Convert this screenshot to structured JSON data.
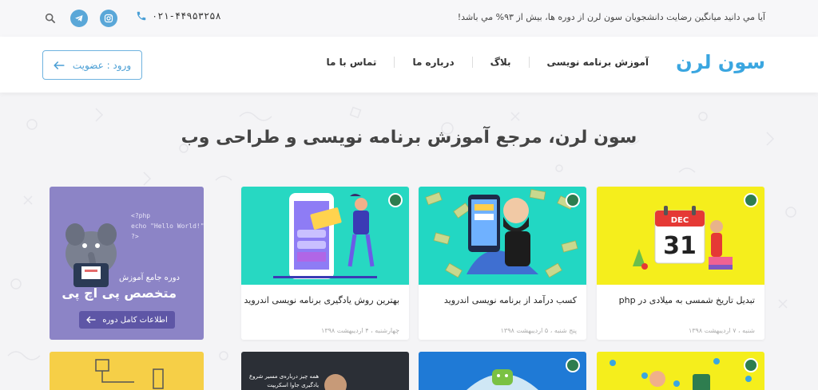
{
  "topbar": {
    "notice": "آيا مي دانيد ميانگين رضايت دانشجويان سون لرن از دوره ها، بيش از ۹۳% مي باشد!",
    "phone": "۰۲۱-۴۴۹۵۳۲۵۸"
  },
  "header": {
    "logo": "سون لرن",
    "login_label": "ورود : عضويت",
    "nav": [
      "آموزش برنامه نويسی",
      "بلاگ",
      "درباره ما",
      "تماس با ما"
    ]
  },
  "hero": {
    "title": "سون لرن، مرجع آموزش برنامه نويسی و طراحی وب"
  },
  "cards": [
    {
      "title": "تبدیل تاریخ شمسی به میلادی در php",
      "date": "شنبه ، ۷ اردیبهشت ۱۳۹۸",
      "calendar_month": "DEC",
      "calendar_day": "31"
    },
    {
      "title": "کسب درآمد از برنامه نويسی اندرويد",
      "date": "پنج شنبه ، ۵ اردیبهشت ۱۳۹۸"
    },
    {
      "title": "بهترین روش یادگیری برنامه نویسی اندروید",
      "date": "چهارشنبه ، ۴ اردیبهشت ۱۳۹۸"
    }
  ],
  "promo": {
    "code_lines": [
      "<?php",
      "echo \"Hello World!\";",
      "?>"
    ],
    "subtitle": "دوره جامع آموزش",
    "title": "متخصص پی اچ پی",
    "button_label": "اطلاعات کامل دوره"
  },
  "bottom_card": {
    "text_line1": "همه چیز درباره‌ی مسیر شروع",
    "text_line2": "یادگیری جاوا اسکریپت"
  },
  "colors": {
    "accent": "#3aa6e0",
    "card1_bg": "#f5ee1c",
    "card2_bg": "#22d7c3",
    "card3_bg": "#27d8c2",
    "promo_bg": "#8c84c6"
  }
}
